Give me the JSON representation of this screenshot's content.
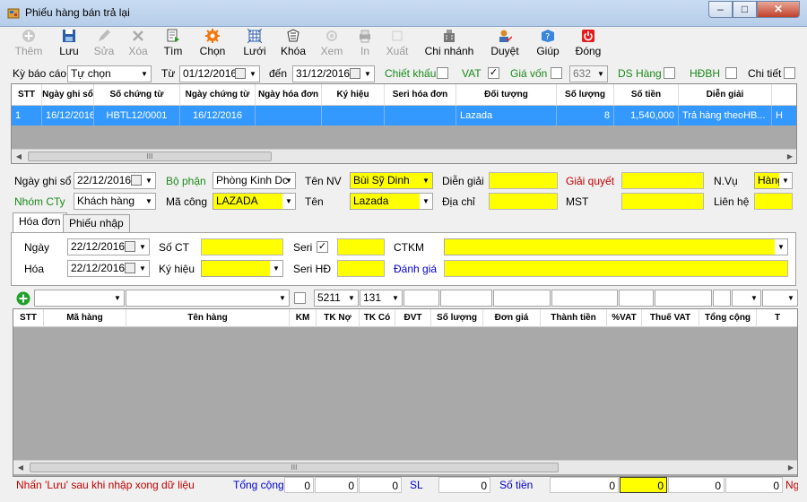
{
  "window": {
    "title": "Phiếu hàng bán trả lại",
    "min": "–",
    "max": "□",
    "close": "✕"
  },
  "toolbar": [
    {
      "label": "Thêm",
      "icon": "add-icon",
      "enabled": false
    },
    {
      "label": "Lưu",
      "icon": "save-icon",
      "enabled": true
    },
    {
      "label": "Sửa",
      "icon": "edit-icon",
      "enabled": false
    },
    {
      "label": "Xóa",
      "icon": "delete-icon",
      "enabled": false
    },
    {
      "label": "Tìm",
      "icon": "find-icon",
      "enabled": true
    },
    {
      "label": "Chọn",
      "icon": "gear-icon",
      "enabled": true
    },
    {
      "label": "Lưới",
      "icon": "grid-icon",
      "enabled": true
    },
    {
      "label": "Khóa",
      "icon": "lock-icon",
      "enabled": true
    },
    {
      "label": "Xem",
      "icon": "view-icon",
      "enabled": false
    },
    {
      "label": "In",
      "icon": "print-icon",
      "enabled": false
    },
    {
      "label": "Xuất",
      "icon": "export-icon",
      "enabled": false
    },
    {
      "label": "Chi nhánh",
      "icon": "branch-icon",
      "enabled": true
    },
    {
      "label": "Duyệt",
      "icon": "approve-icon",
      "enabled": true
    },
    {
      "label": "Giúp",
      "icon": "help-icon",
      "enabled": true
    },
    {
      "label": "Đóng",
      "icon": "power-icon",
      "enabled": true
    }
  ],
  "filter": {
    "period_label": "Kỳ báo cáo",
    "period_value": "Tự chọn",
    "from_label": "Từ",
    "from_value": "01/12/2016",
    "to_label": "đến",
    "to_value": "31/12/2016",
    "discount_label": "Chiết khấu",
    "vat_label": "VAT",
    "vat_checked": true,
    "cost_label": "Giá vốn",
    "cost_code": "632",
    "goods_list_label": "DS Hàng",
    "hdbh_label": "HĐBH",
    "detail_label": "Chi tiết"
  },
  "grid1": {
    "headers": [
      "STT",
      "Ngày ghi sổ",
      "Số chứng từ",
      "Ngày chứng từ",
      "Ngày hóa đơn",
      "Ký hiệu",
      "Seri hóa đơn",
      "Đối tượng",
      "Số lượng",
      "Số tiền",
      "Diễn giải",
      ""
    ],
    "rows": [
      [
        "1",
        "16/12/2016",
        "HBTL12/0001",
        "16/12/2016",
        "",
        "",
        "",
        "Lazada",
        "8",
        "1,540,000",
        "Trả hàng theoHB...",
        "H"
      ]
    ]
  },
  "form": {
    "posting_date_label": "Ngày ghi sổ",
    "posting_date": "22/12/2016",
    "department_label": "Bộ phận",
    "department": "Phòng Kinh Dc",
    "staff_label": "Tên NV",
    "staff": "Bùi Sỹ Dinh",
    "description_label": "Diễn giải",
    "resolve_label": "Giải quyết",
    "op_label": "N.Vụ",
    "op_value": "Hàng",
    "group_label": "Nhóm CTy",
    "group_value": "Khách hàng",
    "company_code_label": "Mã công",
    "company_code": "LAZADA",
    "name_label": "Tên",
    "name_value": "Lazada",
    "address_label": "Địa chỉ",
    "tax_label": "MST",
    "contact_label": "Liên hệ"
  },
  "tabs": [
    "Hóa đơn",
    "Phiếu nhập"
  ],
  "invoice": {
    "date_label": "Ngày",
    "date_value": "22/12/2016",
    "doc_no_label": "Số CT",
    "serial_label": "Seri",
    "serial_checked": true,
    "ctkm_label": "CTKM",
    "invoice_label": "Hóa",
    "invoice_date": "22/12/2016",
    "symbol_label": "Ký hiệu",
    "serial_hd_label": "Seri HĐ",
    "rating_label": "Đánh giá"
  },
  "detail": {
    "debit_account": "5211",
    "credit_account": "131"
  },
  "grid2": {
    "headers": [
      "STT",
      "Mã hàng",
      "Tên hàng",
      "KM",
      "TK Nợ",
      "TK Có",
      "ĐVT",
      "Số lượng",
      "Đơn giá",
      "Thành tiền",
      "%VAT",
      "Thuế VAT",
      "Tổng cộng",
      "T"
    ]
  },
  "status": {
    "hint": "Nhấn 'Lưu' sau khi nhập xong dữ liệu",
    "total_label": "Tổng cộng",
    "t1": "0",
    "t2": "0",
    "t3": "0",
    "sl_label": "SL",
    "sl_value": "0",
    "amount_label": "Số tiền",
    "amount_value": "0",
    "a2": "0",
    "a3": "0",
    "a4": "0",
    "a5": "0",
    "tail": "Ng"
  }
}
